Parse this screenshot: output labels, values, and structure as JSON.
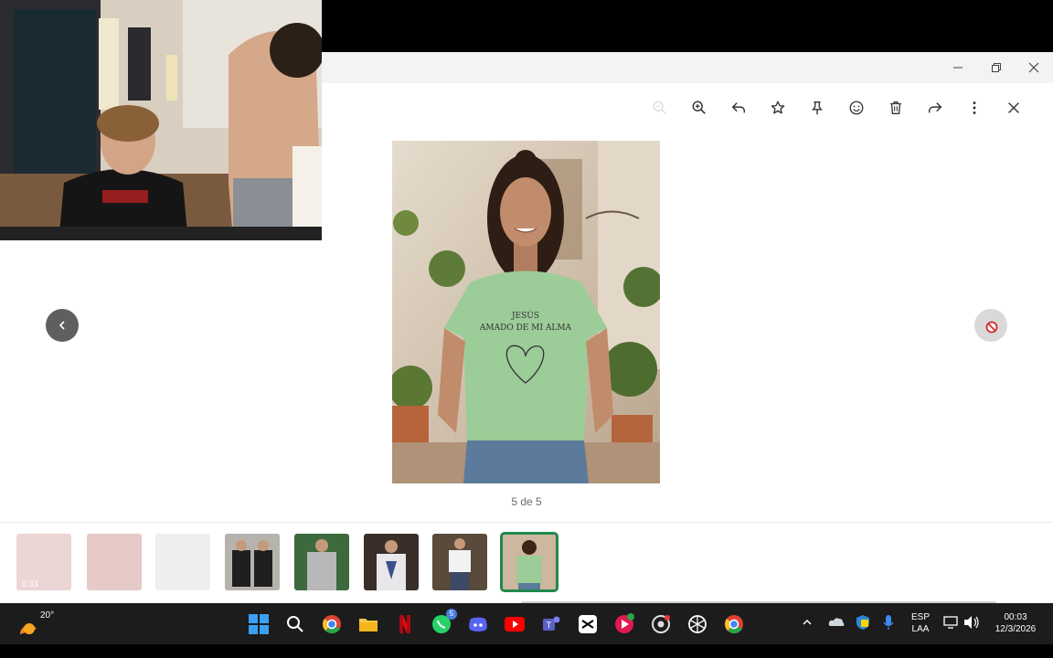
{
  "viewer": {
    "counter": "5 de 5",
    "toolbar": {
      "zoom_out": "zoom-out-icon",
      "zoom_in": "zoom-in-icon",
      "reply": "reply-icon",
      "star": "star-icon",
      "pin": "pin-icon",
      "react": "emoji-icon",
      "delete": "trash-icon",
      "forward": "forward-icon",
      "more": "more-vertical-icon",
      "close": "close-icon"
    },
    "photo": {
      "shirt_text_line1": "JESÚS",
      "shirt_text_line2": "AMADO DE MI ALMA"
    },
    "thumbnails": [
      {
        "kind": "video",
        "duration": "0:33",
        "state": "faded"
      },
      {
        "kind": "image",
        "state": "faded"
      },
      {
        "kind": "image",
        "state": "faded"
      },
      {
        "kind": "image",
        "state": "normal"
      },
      {
        "kind": "image",
        "state": "normal"
      },
      {
        "kind": "image",
        "state": "normal"
      },
      {
        "kind": "image",
        "state": "normal"
      },
      {
        "kind": "image",
        "state": "active"
      }
    ]
  },
  "window_controls": [
    "minimize",
    "restore",
    "close"
  ],
  "taskbar": {
    "weather_temp": "20°",
    "apps": [
      "start",
      "search",
      "chrome",
      "file-explorer",
      "netflix",
      "whatsapp",
      "discord",
      "youtube",
      "teams",
      "capcut",
      "app-red",
      "app-gear",
      "chatgpt",
      "chrome-profile"
    ],
    "whatsapp_badge": "5",
    "tray": {
      "lang_line1": "ESP",
      "lang_line2": "LAA",
      "time": "00:03",
      "date": "12/3/2026"
    }
  },
  "colors": {
    "accent_green": "#1f8a4c",
    "taskbar": "#1c1c1c"
  }
}
